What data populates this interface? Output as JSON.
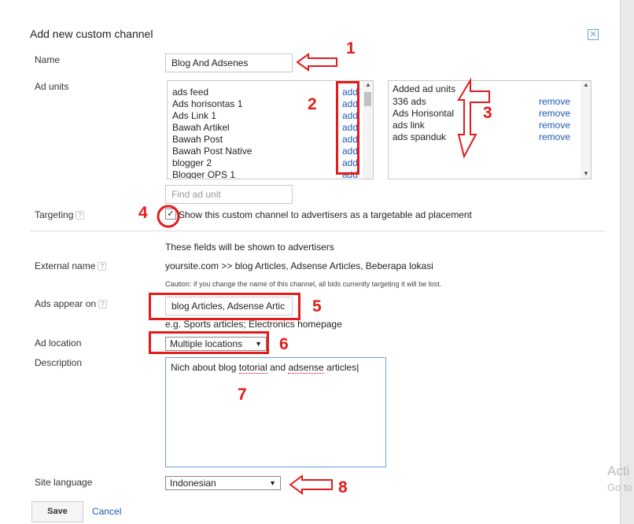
{
  "dialog": {
    "title": "Add new custom channel",
    "close_icon": "close-icon"
  },
  "name": {
    "label": "Name",
    "value": "Blog And Adsenes"
  },
  "ad_units": {
    "label": "Ad units",
    "available": [
      {
        "name": "ads feed",
        "action": "add"
      },
      {
        "name": "Ads horisontas 1",
        "action": "add"
      },
      {
        "name": "Ads Link 1",
        "action": "add"
      },
      {
        "name": "Bawah Artikel",
        "action": "add"
      },
      {
        "name": "Bawah Post",
        "action": "add"
      },
      {
        "name": "Bawah Post Native",
        "action": "add"
      },
      {
        "name": "blogger 2",
        "action": "add"
      },
      {
        "name": "Blogger OPS 1",
        "action": "add"
      }
    ],
    "added_header": "Added ad units",
    "added": [
      {
        "name": "336 ads",
        "action": "remove"
      },
      {
        "name": "Ads Horisontal",
        "action": "remove"
      },
      {
        "name": "ads link",
        "action": "remove"
      },
      {
        "name": "ads spanduk",
        "action": "remove"
      }
    ],
    "find_placeholder": "Find ad unit"
  },
  "targeting": {
    "label": "Targeting",
    "help": "?",
    "checkbox_checked": true,
    "checkbox_label": "Show this custom channel to advertisers as a targetable ad placement"
  },
  "advertiser_fields": {
    "note": "These fields will be shown to advertisers",
    "external_name_label": "External name",
    "external_name_value": "yoursite.com >> blog Articles, Adsense Articles, Beberapa lokasi",
    "caution": "Caution: if you change the name of this channel, all bids currently targeting it will be lost.",
    "ads_appear_label": "Ads appear on",
    "ads_appear_value": "blog Articles, Adsense Artic",
    "ads_appear_hint": "e.g. Sports articles; Electronics homepage",
    "ad_location_label": "Ad location",
    "ad_location_value": "Multiple locations",
    "description_label": "Description",
    "description_text_1": "Nich about blog ",
    "description_text_2": "totorial",
    "description_text_3": " and ",
    "description_text_4": "adsense",
    "description_text_5": " articles"
  },
  "site_language": {
    "label": "Site language",
    "value": "Indonesian"
  },
  "buttons": {
    "save": "Save",
    "cancel": "Cancel"
  },
  "annotations": {
    "n1": "1",
    "n2": "2",
    "n3": "3",
    "n4": "4",
    "n5": "5",
    "n6": "6",
    "n7": "7",
    "n8": "8",
    "color": "#e31b1b"
  },
  "overlay": {
    "activate_1": "Acti",
    "activate_2": "Go to"
  }
}
